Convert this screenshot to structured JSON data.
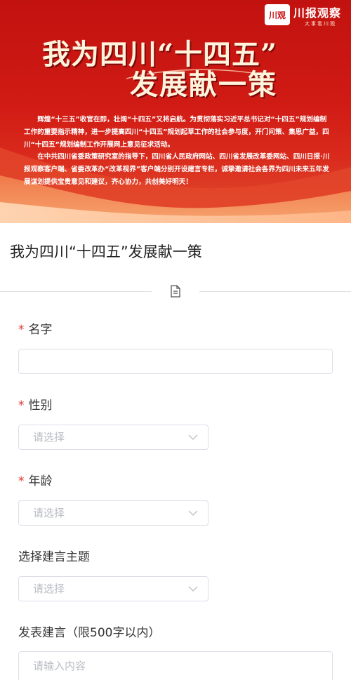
{
  "banner": {
    "logo_mark": "川观",
    "logo_name": "川报观察",
    "logo_slogan": "大事看川观",
    "headline_line1": "我为四川“十四五”",
    "headline_line2": "发展献一策",
    "intro_p1": "辉煌“十三五”收官在即，壮阔“十四五”又将启航。为贯彻落实习近平总书记对“十四五”规划编制工作的重要指示精神，进一步提高四川“十四五”规划起草工作的社会参与度，开门问策、集思广益，四川“十四五”规划编制工作开展网上意见征求活动。",
    "intro_p2": "在中共四川省委政策研究室的指导下，四川省人民政府网站、四川省发展改革委网站、四川日报·川报观察客户端、省委改革办“改革视界”客户端分别开设建言专栏，诚挚邀请社会各界为四川未来五年发展谋划提供宝贵意见和建议，齐心协力，共创美好明天！"
  },
  "form": {
    "title": "我为四川“十四五”发展献一策",
    "required_mark": "*",
    "name_label": "名字",
    "gender_label": "性别",
    "gender_placeholder": "请选择",
    "age_label": "年龄",
    "age_placeholder": "请选择",
    "topic_label": "选择建言主题",
    "topic_placeholder": "请选择",
    "advice_label": "发表建言（限500字以内）",
    "advice_placeholder": "请输入内容"
  },
  "colors": {
    "banner_red": "#c8151b",
    "required_red": "#e23a32",
    "border_gray": "#dcdfe6"
  },
  "icons": {
    "divider_icon": "document-icon",
    "select_icon": "chevron-down-icon"
  }
}
